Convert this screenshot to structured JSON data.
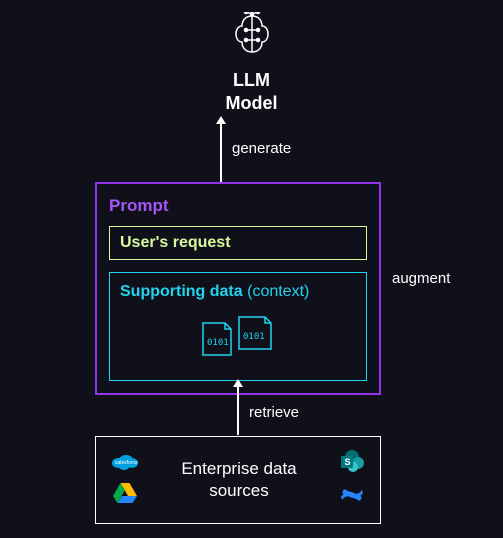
{
  "llm": {
    "title_line1": "LLM",
    "title_line2": "Model"
  },
  "arrows": {
    "generate_label": "generate",
    "retrieve_label": "retrieve",
    "augment_label": "augment"
  },
  "prompt": {
    "title": "Prompt",
    "user_request": "User's request",
    "supporting_bold": "Supporting data",
    "supporting_thin": "(context)"
  },
  "enterprise": {
    "title_line1": "Enterprise data",
    "title_line2": "sources"
  },
  "icons": {
    "brain": "brain-circuit-icon",
    "file1": "binary-file-icon",
    "file2": "binary-file-icon",
    "salesforce": "salesforce-icon",
    "gdrive": "google-drive-icon",
    "sharepoint": "sharepoint-icon",
    "confluence": "confluence-icon"
  }
}
